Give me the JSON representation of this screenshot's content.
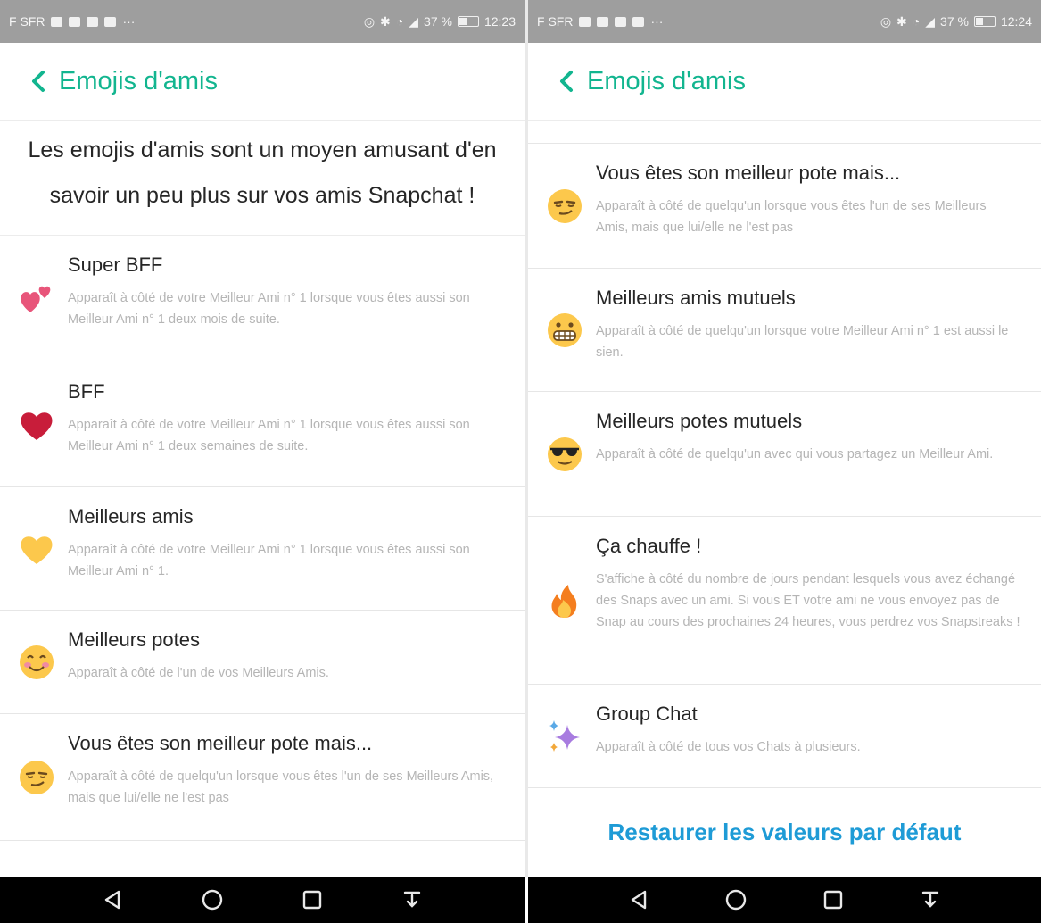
{
  "status_left": {
    "carrier": "F SFR",
    "time": "12:23",
    "battery": "37 %"
  },
  "status_right": {
    "carrier": "F SFR",
    "time": "12:24",
    "battery": "37 %"
  },
  "header": {
    "title": "Emojis d'amis"
  },
  "left": {
    "intro": "Les emojis d'amis sont un moyen amusant d'en savoir un peu plus sur vos amis Snapchat !",
    "items": [
      {
        "name": "Super BFF",
        "icon": "two-hearts-icon",
        "desc": "Apparaît à côté de votre Meilleur Ami n° 1 lorsque vous êtes aussi son Meilleur Ami n° 1 deux mois de suite."
      },
      {
        "name": "BFF",
        "icon": "red-heart-icon",
        "desc": "Apparaît à côté de votre Meilleur Ami n° 1 lorsque vous êtes aussi son Meilleur Ami n° 1 deux semaines de suite."
      },
      {
        "name": "Meilleurs amis",
        "icon": "yellow-heart-icon",
        "desc": "Apparaît à côté de votre Meilleur Ami n° 1 lorsque vous êtes aussi son Meilleur Ami n° 1."
      },
      {
        "name": "Meilleurs potes",
        "icon": "smiling-face-icon",
        "desc": "Apparaît à côté de l'un de vos Meilleurs Amis."
      },
      {
        "name": "Vous êtes son meilleur pote mais...",
        "icon": "smirking-face-icon",
        "desc": "Apparaît à côté de quelqu'un lorsque vous êtes l'un de ses Meilleurs Amis, mais que lui/elle ne l'est pas"
      }
    ]
  },
  "right": {
    "items": [
      {
        "name": "Vous êtes son meilleur pote mais...",
        "icon": "smirking-face-icon",
        "desc": "Apparaît à côté de quelqu'un lorsque vous êtes l'un de ses Meilleurs Amis, mais que lui/elle ne l'est pas"
      },
      {
        "name": "Meilleurs amis mutuels",
        "icon": "grimacing-face-icon",
        "desc": "Apparaît à côté de quelqu'un lorsque votre Meilleur Ami n° 1 est aussi le sien."
      },
      {
        "name": "Meilleurs potes mutuels",
        "icon": "sunglasses-face-icon",
        "desc": "Apparaît à côté de quelqu'un avec qui vous partagez un Meilleur Ami."
      },
      {
        "name": "Ça chauffe !",
        "icon": "fire-icon",
        "desc": "S'affiche à côté du nombre de jours pendant lesquels vous avez échangé des Snaps avec un ami. Si vous ET votre ami ne vous envoyez pas de Snap au cours des prochaines 24 heures, vous perdrez vos Snapstreaks !"
      },
      {
        "name": "Group Chat",
        "icon": "sparkles-icon",
        "desc": "Apparaît à côté de tous vos Chats à plusieurs."
      }
    ],
    "restore_label": "Restaurer les valeurs par défaut"
  },
  "colors": {
    "accent": "#12b58f",
    "link": "#1e9bd6",
    "status_bar": "#9e9e9e",
    "nav_bar": "#000000"
  }
}
